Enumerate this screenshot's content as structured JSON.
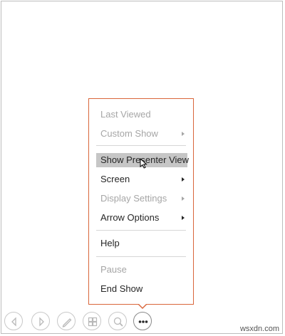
{
  "context_menu": {
    "items": [
      {
        "label": "Last Viewed",
        "enabled": false,
        "submenu": false,
        "highlighted": false
      },
      {
        "label": "Custom Show",
        "enabled": false,
        "submenu": true,
        "highlighted": false
      },
      {
        "label": "Show Presenter View",
        "enabled": true,
        "submenu": false,
        "highlighted": true
      },
      {
        "label": "Screen",
        "enabled": true,
        "submenu": true,
        "highlighted": false
      },
      {
        "label": "Display Settings",
        "enabled": false,
        "submenu": true,
        "highlighted": false
      },
      {
        "label": "Arrow Options",
        "enabled": true,
        "submenu": true,
        "highlighted": false
      },
      {
        "label": "Help",
        "enabled": true,
        "submenu": false,
        "highlighted": false
      },
      {
        "label": "Pause",
        "enabled": false,
        "submenu": false,
        "highlighted": false
      },
      {
        "label": "End Show",
        "enabled": true,
        "submenu": false,
        "highlighted": false
      }
    ],
    "border_color": "#d9663b",
    "highlight_color": "#c6c6c6"
  },
  "toolbar": {
    "buttons": [
      {
        "icon": "previous-icon"
      },
      {
        "icon": "next-icon"
      },
      {
        "icon": "pen-icon"
      },
      {
        "icon": "see-all-slides-icon"
      },
      {
        "icon": "zoom-icon"
      },
      {
        "icon": "more-options-icon"
      }
    ]
  },
  "watermark": "wsxdn.com"
}
